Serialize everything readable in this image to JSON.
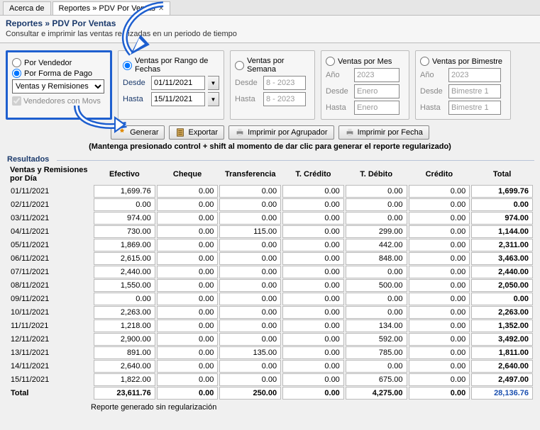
{
  "tabs": {
    "about": "Acerca de",
    "report": "Reportes » PDV Por Ventas"
  },
  "header": {
    "title": "Reportes » PDV Por Ventas",
    "subtitle": "Consultar e imprimir las ventas realizadas en un periodo de tiempo"
  },
  "filters": {
    "porVendedor": "Por Vendedor",
    "porFormaPago": "Por Forma de Pago",
    "combo": "Ventas y Remisiones",
    "vendedoresMovs": "Vendedores con Movs"
  },
  "rangoFechas": {
    "label": "Ventas por Rango de Fechas",
    "desde": "Desde",
    "hasta": "Hasta",
    "desdeVal": "01/11/2021",
    "hastaVal": "15/11/2021"
  },
  "semana": {
    "label": "Ventas por Semana",
    "desde": "Desde",
    "hasta": "Hasta",
    "desdeVal": "8 - 2023",
    "hastaVal": "8 - 2023"
  },
  "mes": {
    "label": "Ventas por Mes",
    "ano": "Año",
    "desde": "Desde",
    "hasta": "Hasta",
    "anoVal": "2023",
    "desdeVal": "Enero",
    "hastaVal": "Enero"
  },
  "bimestre": {
    "label": "Ventas por Bimestre",
    "ano": "Año",
    "desde": "Desde",
    "hasta": "Hasta",
    "anoVal": "2023",
    "desdeVal": "Bimestre 1",
    "hastaVal": "Bimestre 1"
  },
  "buttons": {
    "generar": "Generar",
    "exportar": "Exportar",
    "imprimirAgrupador": "Imprimir por Agrupador",
    "imprimirFecha": "Imprimir por Fecha"
  },
  "hint": "(Mantenga presionado control + shift al momento de dar clic para generar el reporte regularizado)",
  "results": {
    "section": "Resultados",
    "subheader": "Ventas y Remisiones por Día",
    "columns": [
      "Efectivo",
      "Cheque",
      "Transferencia",
      "T. Crédito",
      "T. Débito",
      "Crédito",
      "Total"
    ],
    "rows": [
      {
        "d": "01/11/2021",
        "v": [
          "1,699.76",
          "0.00",
          "0.00",
          "0.00",
          "0.00",
          "0.00",
          "1,699.76"
        ]
      },
      {
        "d": "02/11/2021",
        "v": [
          "0.00",
          "0.00",
          "0.00",
          "0.00",
          "0.00",
          "0.00",
          "0.00"
        ]
      },
      {
        "d": "03/11/2021",
        "v": [
          "974.00",
          "0.00",
          "0.00",
          "0.00",
          "0.00",
          "0.00",
          "974.00"
        ]
      },
      {
        "d": "04/11/2021",
        "v": [
          "730.00",
          "0.00",
          "115.00",
          "0.00",
          "299.00",
          "0.00",
          "1,144.00"
        ]
      },
      {
        "d": "05/11/2021",
        "v": [
          "1,869.00",
          "0.00",
          "0.00",
          "0.00",
          "442.00",
          "0.00",
          "2,311.00"
        ]
      },
      {
        "d": "06/11/2021",
        "v": [
          "2,615.00",
          "0.00",
          "0.00",
          "0.00",
          "848.00",
          "0.00",
          "3,463.00"
        ]
      },
      {
        "d": "07/11/2021",
        "v": [
          "2,440.00",
          "0.00",
          "0.00",
          "0.00",
          "0.00",
          "0.00",
          "2,440.00"
        ]
      },
      {
        "d": "08/11/2021",
        "v": [
          "1,550.00",
          "0.00",
          "0.00",
          "0.00",
          "500.00",
          "0.00",
          "2,050.00"
        ]
      },
      {
        "d": "09/11/2021",
        "v": [
          "0.00",
          "0.00",
          "0.00",
          "0.00",
          "0.00",
          "0.00",
          "0.00"
        ]
      },
      {
        "d": "10/11/2021",
        "v": [
          "2,263.00",
          "0.00",
          "0.00",
          "0.00",
          "0.00",
          "0.00",
          "2,263.00"
        ]
      },
      {
        "d": "11/11/2021",
        "v": [
          "1,218.00",
          "0.00",
          "0.00",
          "0.00",
          "134.00",
          "0.00",
          "1,352.00"
        ]
      },
      {
        "d": "12/11/2021",
        "v": [
          "2,900.00",
          "0.00",
          "0.00",
          "0.00",
          "592.00",
          "0.00",
          "3,492.00"
        ]
      },
      {
        "d": "13/11/2021",
        "v": [
          "891.00",
          "0.00",
          "135.00",
          "0.00",
          "785.00",
          "0.00",
          "1,811.00"
        ]
      },
      {
        "d": "14/11/2021",
        "v": [
          "2,640.00",
          "0.00",
          "0.00",
          "0.00",
          "0.00",
          "0.00",
          "2,640.00"
        ]
      },
      {
        "d": "15/11/2021",
        "v": [
          "1,822.00",
          "0.00",
          "0.00",
          "0.00",
          "675.00",
          "0.00",
          "2,497.00"
        ]
      }
    ],
    "totalLabel": "Total",
    "totals": [
      "23,611.76",
      "0.00",
      "250.00",
      "0.00",
      "4,275.00",
      "0.00",
      "28,136.76"
    ],
    "footer": "Reporte generado sin regularización"
  }
}
